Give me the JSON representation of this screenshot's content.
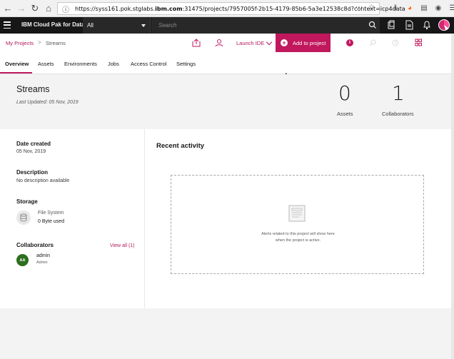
{
  "browser": {
    "url_prefix": "https://syss161.pok.stglabs.",
    "url_domain": "ibm.com",
    "url_rest": ":31475/projects/7957005f-2b15-4179-85b6-5a3e12538c8d?context=icp4data",
    "more_icon": "ellipsis-icon"
  },
  "header": {
    "brand": "IBM Cloud Pak for Data",
    "scope": "All",
    "search_placeholder": "Search"
  },
  "project_bar": {
    "breadcrumb_root": "My Projects",
    "breadcrumb_sep": ">",
    "breadcrumb_current": "Streams",
    "launch_ide": "Launch IDE",
    "add_to_project": "Add to project",
    "info_glyph": "i"
  },
  "tabs": [
    "Overview",
    "Assets",
    "Environments",
    "Jobs",
    "Access Control",
    "Settings"
  ],
  "summary": {
    "title": "Streams",
    "last_updated": "Last Updated:  05 Nov, 2019",
    "stats": [
      {
        "value": "0",
        "label": "Assets"
      },
      {
        "value": "1",
        "label": "Collaborators"
      }
    ]
  },
  "details": {
    "date_created_label": "Date created",
    "date_created_value": "05 Nov, 2019",
    "description_label": "Description",
    "description_value": "No description available",
    "storage_label": "Storage",
    "storage_type": "File System",
    "storage_used": "0 Byte used",
    "collaborators_label": "Collaborators",
    "view_all": "View all (1)",
    "collaborator": {
      "initials": "AA",
      "name": "admin",
      "role": "Admin"
    }
  },
  "activity": {
    "title": "Recent activity",
    "empty_line1": "Alerts related to this project will show here",
    "empty_line2": "when the project is active."
  },
  "colors": {
    "accent": "#c0175d",
    "link": "#b3195a",
    "header_bg": "#171717",
    "avatar_green": "#2d6e1f"
  }
}
